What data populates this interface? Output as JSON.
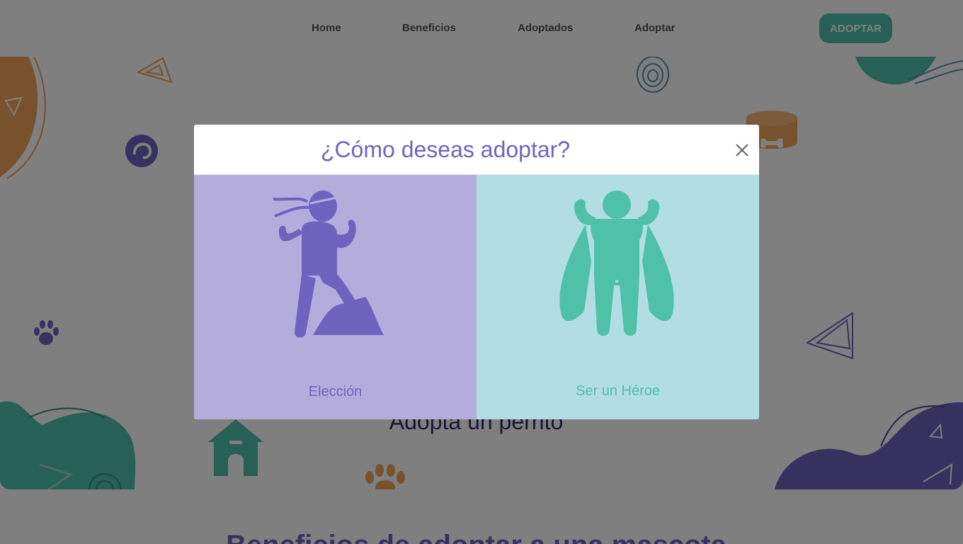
{
  "nav": {
    "links": [
      "Home",
      "Beneficios",
      "Adoptados",
      "Adoptar"
    ],
    "cta_label": "ADOPTAR"
  },
  "hero": {
    "title": "Adopta un perrito"
  },
  "section": {
    "title": "Beneficios de adoptar a una mascota"
  },
  "modal": {
    "title": "¿Cómo deseas adoptar?",
    "options": [
      {
        "label": "Elección",
        "icon": "climbing-person-icon"
      },
      {
        "label": "Ser un Héroe",
        "icon": "superhero-icon"
      }
    ]
  },
  "colors": {
    "purple": "#6f63bf",
    "teal": "#4fc1a9",
    "orange": "#f0a35a",
    "lavender": "#b4addc",
    "light_blue": "#b1dde3"
  }
}
